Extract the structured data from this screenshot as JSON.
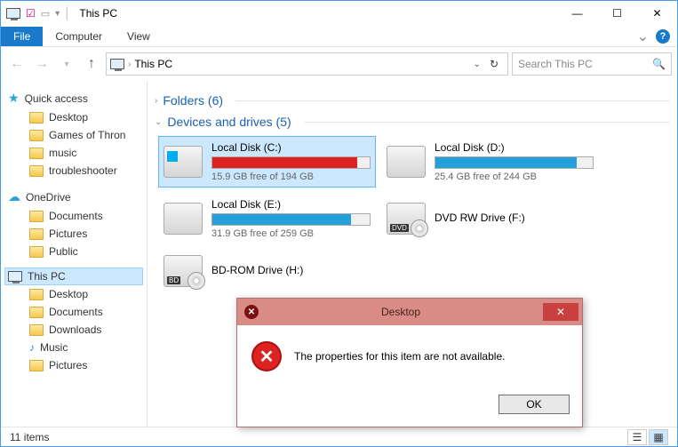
{
  "window": {
    "title": "This PC",
    "min": "—",
    "max": "☐",
    "close": "✕"
  },
  "ribbon": {
    "file": "File",
    "computer": "Computer",
    "view": "View",
    "help": "?",
    "expand": "⌄"
  },
  "address": {
    "path": "This PC",
    "search_placeholder": "Search This PC"
  },
  "sidebar": {
    "quick_access": "Quick access",
    "qa_items": [
      "Desktop",
      "Games of Thron",
      "music",
      "troubleshooter"
    ],
    "onedrive": "OneDrive",
    "od_items": [
      "Documents",
      "Pictures",
      "Public"
    ],
    "this_pc": "This PC",
    "pc_items": [
      "Desktop",
      "Documents",
      "Downloads",
      "Music",
      "Pictures"
    ]
  },
  "groups": {
    "folders": "Folders (6)",
    "devices": "Devices and drives (5)"
  },
  "drives": [
    {
      "name": "Local Disk (C:)",
      "free_text": "15.9 GB free of 194 GB",
      "fill_pct": 92,
      "color": "#d22",
      "selected": true,
      "type": "os",
      "has_bar": true
    },
    {
      "name": "Local Disk (D:)",
      "free_text": "25.4 GB free of 244 GB",
      "fill_pct": 90,
      "color": "#26a0da",
      "selected": false,
      "type": "hdd",
      "has_bar": true
    },
    {
      "name": "Local Disk (E:)",
      "free_text": "31.9 GB free of 259 GB",
      "fill_pct": 88,
      "color": "#26a0da",
      "selected": false,
      "type": "hdd",
      "has_bar": true
    },
    {
      "name": "DVD RW Drive (F:)",
      "free_text": "",
      "fill_pct": 0,
      "color": "",
      "selected": false,
      "type": "dvd",
      "has_bar": false
    },
    {
      "name": "BD-ROM Drive (H:)",
      "free_text": "",
      "fill_pct": 0,
      "color": "",
      "selected": false,
      "type": "bd",
      "has_bar": false
    }
  ],
  "status": {
    "count": "11 items"
  },
  "dialog": {
    "title": "Desktop",
    "message": "The properties for this item are not available.",
    "ok": "OK"
  }
}
